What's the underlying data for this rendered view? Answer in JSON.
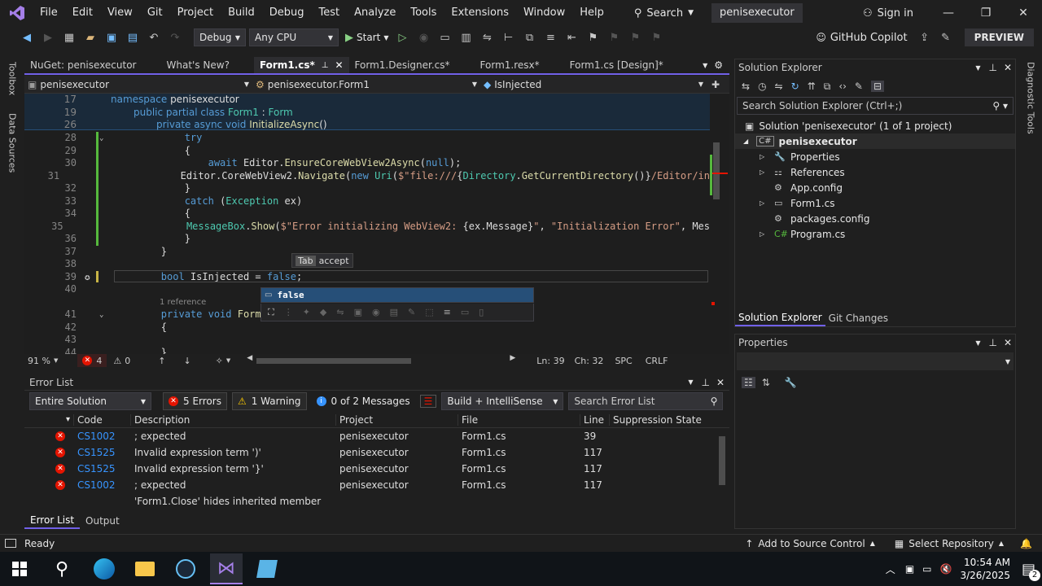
{
  "app": {
    "menu": [
      "File",
      "Edit",
      "View",
      "Git",
      "Project",
      "Build",
      "Debug",
      "Test",
      "Analyze",
      "Tools",
      "Extensions",
      "Window",
      "Help"
    ],
    "search_label": "Search",
    "solution_badge": "penisexecutor",
    "sign_in": "Sign in",
    "accent": "#7160e8"
  },
  "toolbar": {
    "config": "Debug",
    "platform": "Any CPU",
    "start_label": "Start",
    "copilot": "GitHub Copilot",
    "preview": "PREVIEW"
  },
  "left_rail": [
    "Toolbox",
    "Data Sources"
  ],
  "right_rail": [
    "Diagnostic Tools"
  ],
  "doc_tabs": [
    {
      "label": "NuGet: penisexecutor",
      "active": false
    },
    {
      "label": "What's New?",
      "active": false
    },
    {
      "label": "Form1.cs*",
      "active": true
    },
    {
      "label": "Form1.Designer.cs*",
      "active": false
    },
    {
      "label": "Form1.resx*",
      "active": false
    },
    {
      "label": "Form1.cs [Design]*",
      "active": false
    }
  ],
  "navbar": {
    "project": "penisexecutor",
    "type": "penisexecutor.Form1",
    "member": "IsInjected"
  },
  "editor": {
    "sticky_lines": [
      {
        "num": "17",
        "indent": 0,
        "tokens": [
          [
            "kw",
            "namespace "
          ],
          [
            "id",
            "penisexecutor"
          ]
        ]
      },
      {
        "num": "19",
        "indent": 4,
        "tokens": [
          [
            "kw",
            "public partial class "
          ],
          [
            "ty",
            "Form1"
          ],
          [
            "id",
            " : "
          ],
          [
            "ty",
            "Form"
          ]
        ]
      },
      {
        "num": "26",
        "indent": 8,
        "tokens": [
          [
            "kw",
            "private async void "
          ],
          [
            "fn",
            "InitializeAsync"
          ],
          [
            "id",
            "()"
          ]
        ]
      }
    ],
    "lines": [
      {
        "num": "28",
        "tokens": [
          [
            "id",
            "            "
          ],
          [
            "kw",
            "try"
          ]
        ]
      },
      {
        "num": "29",
        "tokens": [
          [
            "id",
            "            {"
          ]
        ]
      },
      {
        "num": "30",
        "tokens": [
          [
            "id",
            "                "
          ],
          [
            "kw",
            "await "
          ],
          [
            "id",
            "Editor."
          ],
          [
            "fn",
            "EnsureCoreWebView2Async"
          ],
          [
            "id",
            "("
          ],
          [
            "kw",
            "null"
          ],
          [
            "id",
            ");"
          ]
        ]
      },
      {
        "num": "31",
        "tokens": [
          [
            "id",
            "                Editor.CoreWebView2."
          ],
          [
            "fn",
            "Navigate"
          ],
          [
            "id",
            "("
          ],
          [
            "kw",
            "new "
          ],
          [
            "ty",
            "Uri"
          ],
          [
            "id",
            "("
          ],
          [
            "str",
            "$\"file:///"
          ],
          [
            "id",
            "{"
          ],
          [
            "ty",
            "Directory"
          ],
          [
            "id",
            "."
          ],
          [
            "fn",
            "GetCurrentDirectory"
          ],
          [
            "id",
            "()}"
          ],
          [
            "str",
            "/Editor/in"
          ]
        ]
      },
      {
        "num": "32",
        "tokens": [
          [
            "id",
            "            }"
          ]
        ]
      },
      {
        "num": "33",
        "tokens": [
          [
            "id",
            "            "
          ],
          [
            "kw",
            "catch "
          ],
          [
            "id",
            "("
          ],
          [
            "ty",
            "Exception "
          ],
          [
            "id",
            "ex)"
          ]
        ]
      },
      {
        "num": "34",
        "tokens": [
          [
            "id",
            "            {"
          ]
        ]
      },
      {
        "num": "35",
        "tokens": [
          [
            "id",
            "                "
          ],
          [
            "ty",
            "MessageBox"
          ],
          [
            "id",
            "."
          ],
          [
            "fn",
            "Show"
          ],
          [
            "id",
            "("
          ],
          [
            "str",
            "$\"Error initializing WebView2: "
          ],
          [
            "id",
            "{ex.Message}"
          ],
          [
            "str",
            "\""
          ],
          [
            "id",
            ", "
          ],
          [
            "str",
            "\"Initialization Error\""
          ],
          [
            "id",
            ", Mes"
          ]
        ]
      },
      {
        "num": "36",
        "tokens": [
          [
            "id",
            "            }"
          ]
        ]
      },
      {
        "num": "37",
        "tokens": [
          [
            "id",
            "        }"
          ]
        ]
      },
      {
        "num": "38",
        "tokens": [
          [
            "id",
            ""
          ]
        ]
      },
      {
        "num": "39",
        "tokens": [
          [
            "id",
            "        "
          ],
          [
            "kw",
            "bool "
          ],
          [
            "id",
            "IsInjected = "
          ],
          [
            "kw",
            "false"
          ],
          [
            "id",
            ";"
          ]
        ]
      },
      {
        "num": "40",
        "tokens": [
          [
            "id",
            ""
          ]
        ]
      },
      {
        "num": "",
        "ref": "1 reference",
        "tokens": []
      },
      {
        "num": "41",
        "tokens": [
          [
            "id",
            "        "
          ],
          [
            "kw",
            "private void "
          ],
          [
            "fn",
            "Form1"
          ]
        ]
      },
      {
        "num": "42",
        "tokens": [
          [
            "id",
            "        {"
          ]
        ]
      },
      {
        "num": "43",
        "tokens": [
          [
            "id",
            ""
          ]
        ]
      },
      {
        "num": "44",
        "tokens": [
          [
            "id",
            "        }"
          ]
        ]
      }
    ],
    "tab_hint_key": "Tab",
    "tab_hint_action": "accept",
    "completion": "false"
  },
  "editor_status": {
    "zoom": "91 %",
    "errors": "4",
    "warnings": "0",
    "line": "Ln: 39",
    "col": "Ch: 32",
    "spc": "SPC",
    "crlf": "CRLF"
  },
  "error_list": {
    "title": "Error List",
    "scope": "Entire Solution",
    "errors_btn": "5 Errors",
    "warnings_btn": "1 Warning",
    "messages_btn": "0 of 2 Messages",
    "build_filter": "Build + IntelliSense",
    "search_placeholder": "Search Error List",
    "columns": [
      "Code",
      "Description",
      "Project",
      "File",
      "Line",
      "Suppression State"
    ],
    "rows": [
      {
        "code": "CS1002",
        "desc": "; expected",
        "project": "penisexecutor",
        "file": "Form1.cs",
        "line": "39"
      },
      {
        "code": "CS1525",
        "desc": "Invalid expression term ')'",
        "project": "penisexecutor",
        "file": "Form1.cs",
        "line": "117"
      },
      {
        "code": "CS1525",
        "desc": "Invalid expression term '}'",
        "project": "penisexecutor",
        "file": "Form1.cs",
        "line": "117"
      },
      {
        "code": "CS1002",
        "desc": "; expected",
        "project": "penisexecutor",
        "file": "Form1.cs",
        "line": "117"
      },
      {
        "code": "",
        "desc": "'Form1.Close' hides inherited member",
        "project": "",
        "file": "",
        "line": ""
      }
    ]
  },
  "bottom_tabs": [
    "Error List",
    "Output"
  ],
  "solution_explorer": {
    "title": "Solution Explorer",
    "search_placeholder": "Search Solution Explorer (Ctrl+;)",
    "solution": "Solution 'penisexecutor' (1 of 1 project)",
    "project": "penisexecutor",
    "items": [
      {
        "label": "Properties",
        "expander": true,
        "icon": "wrench-icon"
      },
      {
        "label": "References",
        "expander": true,
        "icon": "references-icon"
      },
      {
        "label": "App.config",
        "expander": false,
        "icon": "config-file-icon"
      },
      {
        "label": "Form1.cs",
        "expander": true,
        "icon": "form-icon"
      },
      {
        "label": "packages.config",
        "expander": false,
        "icon": "config-file-icon"
      },
      {
        "label": "Program.cs",
        "expander": true,
        "icon": "csharp-file-icon"
      }
    ],
    "bottom_tabs": [
      "Solution Explorer",
      "Git Changes"
    ]
  },
  "properties": {
    "title": "Properties"
  },
  "statusbar": {
    "ready": "Ready",
    "source_control": "Add to Source Control",
    "repository": "Select Repository"
  },
  "taskbar": {
    "time": "10:54 AM",
    "date": "3/26/2025",
    "notifications": "2"
  }
}
